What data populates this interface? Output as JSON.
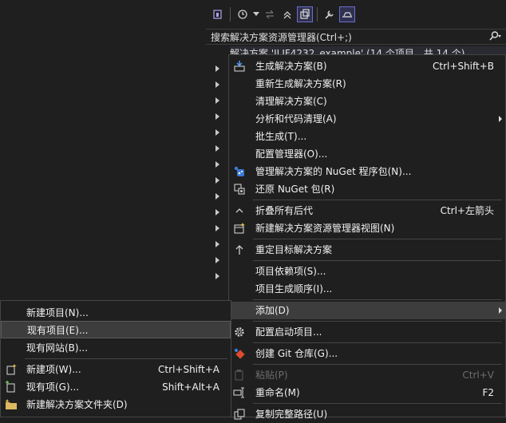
{
  "search": {
    "text": "搜索解决方案资源管理器(Ctrl+;)"
  },
  "root_row": {
    "text": "解决方案 'JLJF4232_example' (14 个项目，共 14 个)"
  },
  "context_menu": {
    "items": [
      {
        "label": "生成解决方案(B)",
        "shortcut": "Ctrl+Shift+B",
        "icon": "build-icon"
      },
      {
        "label": "重新生成解决方案(R)",
        "shortcut": ""
      },
      {
        "label": "清理解决方案(C)",
        "shortcut": ""
      },
      {
        "label": "分析和代码清理(A)",
        "shortcut": "",
        "submenu": true
      },
      {
        "label": "批生成(T)...",
        "shortcut": ""
      },
      {
        "label": "配置管理器(O)...",
        "shortcut": ""
      },
      {
        "label": "管理解决方案的 NuGet 程序包(N)...",
        "shortcut": "",
        "icon": "nuget-icon"
      },
      {
        "label": "还原 NuGet 包(R)",
        "shortcut": "",
        "icon": "restore-icon"
      },
      {
        "label": "折叠所有后代",
        "shortcut": "Ctrl+左箭头",
        "icon": "collapse-icon"
      },
      {
        "label": "新建解决方案资源管理器视图(N)",
        "shortcut": "",
        "icon": "new-view-icon"
      },
      {
        "label": "重定目标解决方案",
        "shortcut": "",
        "icon": "retarget-icon"
      },
      {
        "label": "项目依赖项(S)...",
        "shortcut": ""
      },
      {
        "label": "项目生成顺序(I)...",
        "shortcut": ""
      },
      {
        "label": "添加(D)",
        "shortcut": "",
        "submenu": true
      },
      {
        "label": "配置启动项目...",
        "shortcut": "",
        "icon": "gear-icon"
      },
      {
        "label": "创建 Git 仓库(G)...",
        "shortcut": "",
        "icon": "git-icon"
      },
      {
        "label": "粘贴(P)",
        "shortcut": "Ctrl+V",
        "icon": "paste-icon"
      },
      {
        "label": "重命名(M)",
        "shortcut": "F2",
        "icon": "rename-icon"
      },
      {
        "label": "复制完整路径(U)",
        "shortcut": "",
        "icon": "copy-path-icon"
      }
    ]
  },
  "submenu": {
    "items": [
      {
        "label": "新建项目(N)...",
        "shortcut": ""
      },
      {
        "label": "现有项目(E)...",
        "shortcut": ""
      },
      {
        "label": "现有网站(B)...",
        "shortcut": ""
      },
      {
        "label": "新建项(W)...",
        "shortcut": "Ctrl+Shift+A",
        "icon": "new-item-icon"
      },
      {
        "label": "现有项(G)...",
        "shortcut": "Shift+Alt+A",
        "icon": "existing-item-icon"
      },
      {
        "label": "新建解决方案文件夹(D)",
        "shortcut": "",
        "icon": "folder-icon"
      }
    ]
  },
  "colors": {
    "accent": "#6c6cd0",
    "menu_bg": "#1f1f1f",
    "highlight": "#3d3d3d"
  }
}
